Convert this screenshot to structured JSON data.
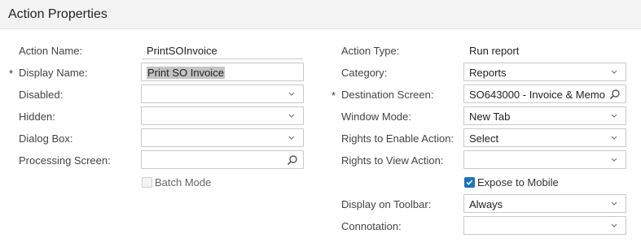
{
  "header": {
    "title": "Action Properties"
  },
  "left": {
    "action_name": {
      "label": "Action Name:",
      "value": "PrintSOInvoice"
    },
    "display_name": {
      "label": "Display Name:",
      "value": "Print SO Invoice",
      "required_mark": "*"
    },
    "disabled": {
      "label": "Disabled:",
      "value": ""
    },
    "hidden": {
      "label": "Hidden:",
      "value": ""
    },
    "dialog_box": {
      "label": "Dialog Box:",
      "value": ""
    },
    "processing_screen": {
      "label": "Processing Screen:",
      "value": ""
    },
    "batch_mode": {
      "label": "Batch Mode",
      "checked": false
    }
  },
  "right": {
    "action_type": {
      "label": "Action Type:",
      "value": "Run report"
    },
    "category": {
      "label": "Category:",
      "value": "Reports"
    },
    "destination_screen": {
      "label": "Destination Screen:",
      "value": "SO643000 - Invoice & Memo",
      "required_mark": "*"
    },
    "window_mode": {
      "label": "Window Mode:",
      "value": "New Tab"
    },
    "rights_enable": {
      "label": "Rights to Enable Action:",
      "value": "Select"
    },
    "rights_view": {
      "label": "Rights to View Action:",
      "value": ""
    },
    "expose_mobile": {
      "label": "Expose to Mobile",
      "checked": true
    },
    "display_toolbar": {
      "label": "Display on Toolbar:",
      "value": "Always"
    },
    "connotation": {
      "label": "Connotation:",
      "value": ""
    }
  },
  "icons": {
    "dropdown": "chevron-down-icon",
    "lookup": "magnifier-icon",
    "checkmark": "check-icon"
  },
  "colors": {
    "accent": "#1f73b7",
    "border": "#c9c9c9",
    "header_bg": "#f3f3f3"
  }
}
